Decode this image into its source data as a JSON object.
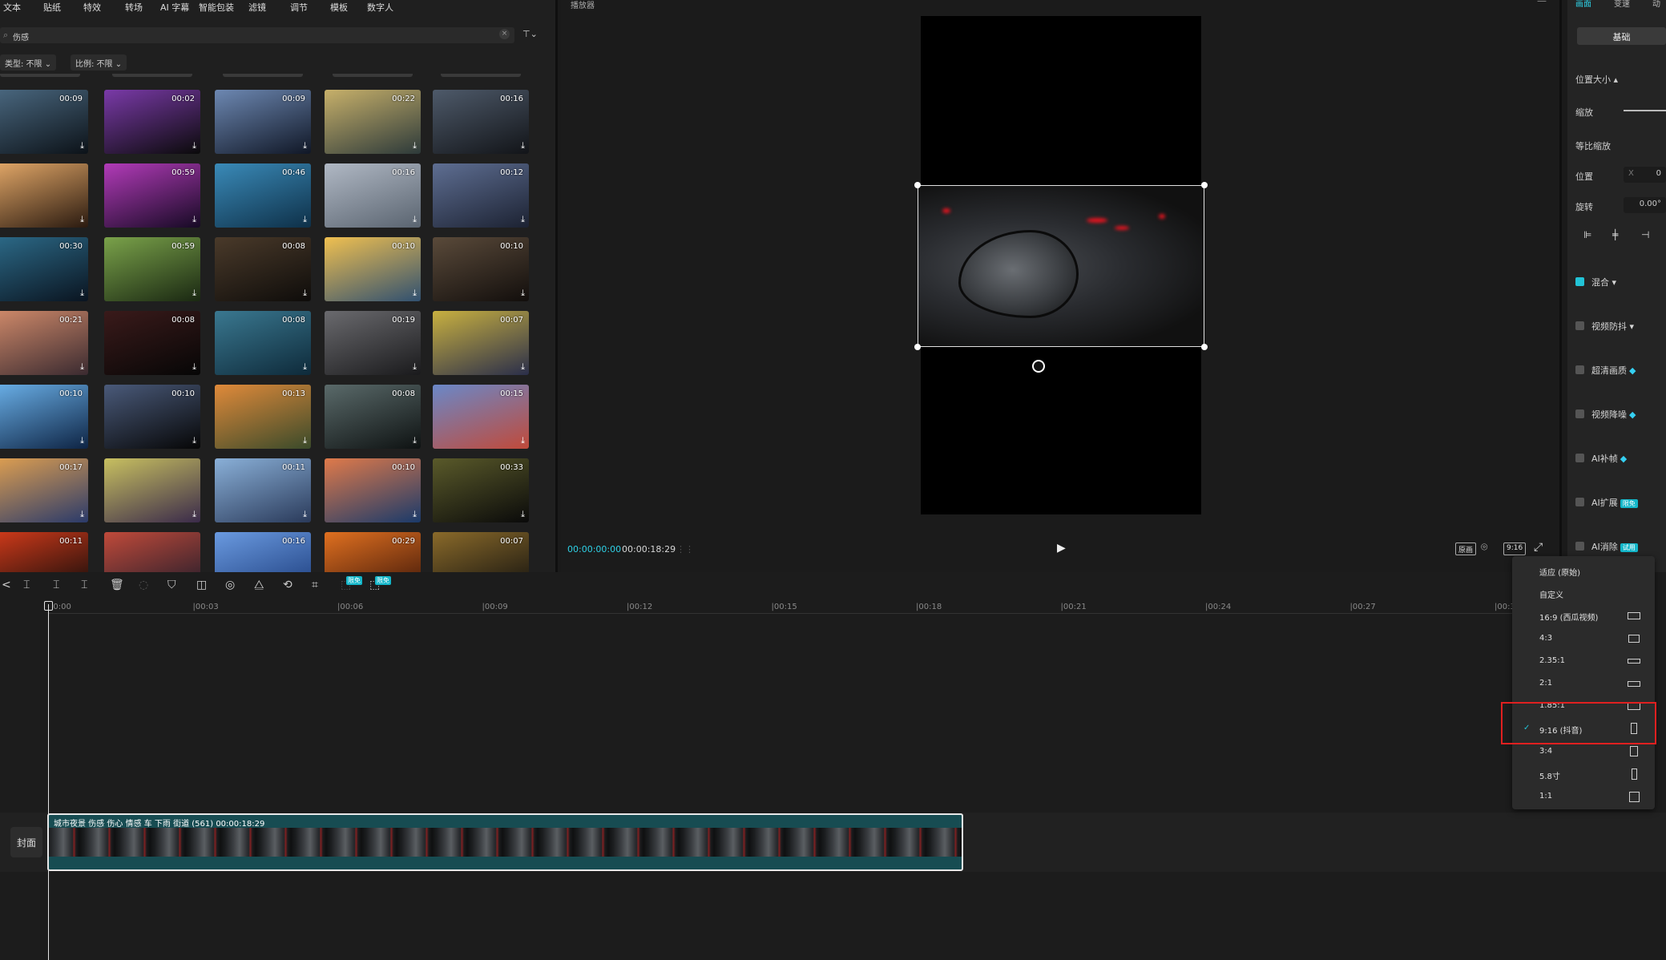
{
  "top_tabs": [
    "文本",
    "贴纸",
    "特效",
    "转场",
    "AI 字幕",
    "智能包装",
    "滤镜",
    "调节",
    "模板",
    "数字人"
  ],
  "search": {
    "query": "伤感",
    "clear_icon": "×",
    "filter_icon": "filter-icon"
  },
  "chips": [
    {
      "label": "类型: 不限 ⌄"
    },
    {
      "label": "比例: 不限 ⌄"
    }
  ],
  "thumbnails": [
    {
      "duration": "00:09",
      "colors": [
        "#4a6880",
        "#0c1218"
      ]
    },
    {
      "duration": "00:02",
      "colors": [
        "#7a3aa8",
        "#0a0a0a"
      ]
    },
    {
      "duration": "00:09",
      "colors": [
        "#6d88b2",
        "#101726"
      ]
    },
    {
      "duration": "00:22",
      "colors": [
        "#c7b06a",
        "#2d3a3a"
      ]
    },
    {
      "duration": "00:16",
      "colors": [
        "#4e5a6a",
        "#121418"
      ]
    },
    {
      "duration": "",
      "colors": [
        "#e3a868",
        "#2a1a10"
      ]
    },
    {
      "duration": "00:59",
      "colors": [
        "#b23bb8",
        "#160a24"
      ]
    },
    {
      "duration": "00:46",
      "colors": [
        "#3a8ab8",
        "#0e3048"
      ]
    },
    {
      "duration": "00:16",
      "colors": [
        "#b0b8c4",
        "#5a6470"
      ]
    },
    {
      "duration": "00:12",
      "colors": [
        "#5e6e92",
        "#1c2232"
      ]
    },
    {
      "duration": "00:30",
      "colors": [
        "#2c6a88",
        "#0a1420"
      ]
    },
    {
      "duration": "00:59",
      "colors": [
        "#7aa24a",
        "#1a2812"
      ]
    },
    {
      "duration": "00:08",
      "colors": [
        "#4a3a2a",
        "#0e0c0a"
      ]
    },
    {
      "duration": "00:10",
      "colors": [
        "#f0c050",
        "#305070"
      ]
    },
    {
      "duration": "00:10",
      "colors": [
        "#5a4a3a",
        "#120e0c"
      ]
    },
    {
      "duration": "00:21",
      "colors": [
        "#d08a6a",
        "#3a2a30"
      ]
    },
    {
      "duration": "00:08",
      "colors": [
        "#3a1a1a",
        "#060606"
      ]
    },
    {
      "duration": "00:08",
      "colors": [
        "#3a7890",
        "#0e2a3a"
      ]
    },
    {
      "duration": "00:19",
      "colors": [
        "#6a6a6e",
        "#1a1a1c"
      ]
    },
    {
      "duration": "00:07",
      "colors": [
        "#c8b040",
        "#2a2e4a"
      ]
    },
    {
      "duration": "00:10",
      "colors": [
        "#6ab0e8",
        "#0e2444"
      ]
    },
    {
      "duration": "00:10",
      "colors": [
        "#4a5a7a",
        "#060606"
      ]
    },
    {
      "duration": "00:13",
      "colors": [
        "#e08a3a",
        "#3a4a2a"
      ]
    },
    {
      "duration": "00:08",
      "colors": [
        "#5a6a6a",
        "#0e1212"
      ]
    },
    {
      "duration": "00:15",
      "colors": [
        "#6a88c8",
        "#c04a3a"
      ]
    },
    {
      "duration": "00:17",
      "colors": [
        "#e0a050",
        "#2a3a6a"
      ]
    },
    {
      "duration": "",
      "colors": [
        "#c8c060",
        "#3a2a4a"
      ]
    },
    {
      "duration": "00:11",
      "colors": [
        "#8ab0d8",
        "#2a3a5a"
      ]
    },
    {
      "duration": "00:10",
      "colors": [
        "#e07a4a",
        "#1a3a6a"
      ]
    },
    {
      "duration": "00:33",
      "colors": [
        "#5a5a2a",
        "#0a0a0a"
      ]
    },
    {
      "duration": "00:11",
      "colors": [
        "#d03a1a",
        "#0a0a0a"
      ]
    },
    {
      "duration": "",
      "colors": [
        "#c04a3a",
        "#1a1a2a"
      ]
    },
    {
      "duration": "00:16",
      "colors": [
        "#6a9ae0",
        "#1a3a7a"
      ]
    },
    {
      "duration": "00:29",
      "colors": [
        "#e07020",
        "#3a1408"
      ]
    },
    {
      "duration": "00:07",
      "colors": [
        "#8a6a2a",
        "#0e0e0e"
      ]
    }
  ],
  "player": {
    "title": "播放器",
    "current_time": "00:00:00:00",
    "total_time": "00:00:18:29",
    "grid_label": "⋮⋮",
    "ratio_button": "9:16",
    "original_button": "原画"
  },
  "props": {
    "tabs": [
      "画面",
      "变速",
      "动"
    ],
    "basic_button": "基础",
    "section_position": "位置大小 ▴",
    "scale_label": "缩放",
    "uniform_scale_label": "等比缩放",
    "position_label": "位置",
    "position_x_label": "X",
    "position_x_value": "0",
    "rotate_label": "旋转",
    "rotate_value": "0.00°",
    "options": [
      {
        "label": "混合 ▾",
        "checked": true,
        "badge": "",
        "diamond": false
      },
      {
        "label": "视频防抖 ▾",
        "checked": false,
        "badge": "",
        "diamond": false
      },
      {
        "label": "超清画质",
        "checked": false,
        "badge": "",
        "diamond": true
      },
      {
        "label": "视频降噪",
        "checked": false,
        "badge": "",
        "diamond": true
      },
      {
        "label": "AI补帧",
        "checked": false,
        "badge": "",
        "diamond": true
      },
      {
        "label": "AI扩展",
        "checked": false,
        "badge": "限免",
        "diamond": false
      },
      {
        "label": "AI消除",
        "checked": false,
        "badge": "试用",
        "diamond": false
      }
    ]
  },
  "timeline": {
    "ruler_ticks": [
      "00:00",
      "|00:03",
      "|00:06",
      "|00:09",
      "|00:12",
      "|00:15",
      "|00:18",
      "|00:21",
      "|00:24",
      "|00:27",
      "|00:3"
    ],
    "tool_badges": [
      "限免",
      "限免"
    ],
    "cover_label": "封面",
    "clip_label": "城市夜景 伤感 伤心 情感 车 下雨 街道 (561)   00:00:18:29"
  },
  "ratio_menu": {
    "items": [
      {
        "label": "适应 (原始)",
        "shape": "none",
        "checked": false
      },
      {
        "label": "自定义",
        "shape": "none",
        "checked": false
      },
      {
        "label": "16:9 (西瓜视频)",
        "shape": "wide",
        "checked": false
      },
      {
        "label": "4:3",
        "shape": "43",
        "checked": false
      },
      {
        "label": "2.35:1",
        "shape": "ultra",
        "checked": false
      },
      {
        "label": "2:1",
        "shape": "21",
        "checked": false
      },
      {
        "label": "1.85:1",
        "shape": "wide",
        "checked": false
      },
      {
        "label": "9:16 (抖音)",
        "shape": "tall",
        "checked": true
      },
      {
        "label": "3:4",
        "shape": "34",
        "checked": false
      },
      {
        "label": "5.8寸",
        "shape": "phone",
        "checked": false
      },
      {
        "label": "1:1",
        "shape": "square",
        "checked": false
      }
    ],
    "check_mark": "✓",
    "highlight_color": "#e02020"
  }
}
